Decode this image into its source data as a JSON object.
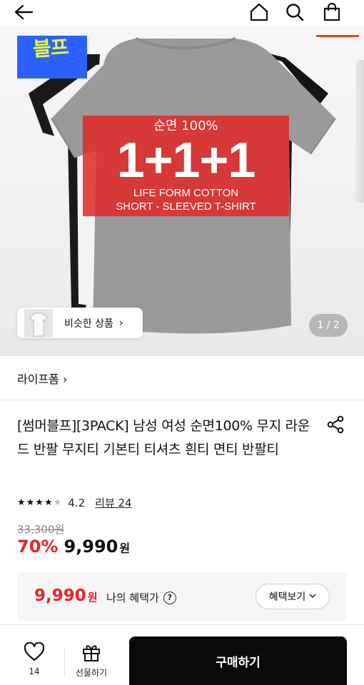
{
  "header": {
    "back_icon": "back-arrow-icon",
    "home_icon": "home-icon",
    "search_icon": "search-icon",
    "cart_icon": "shopping-bag-icon"
  },
  "hero": {
    "logo_text": "블프",
    "promo_line1": "순면 100%",
    "promo_line2": "1+1+1",
    "promo_line3": "LIFE FORM COTTON",
    "promo_line4": "SHORT - SLEEVED T-SHIRT",
    "similar_label": "비슷한 상품",
    "similar_chevron": "›",
    "pager": "1 / 2",
    "colors": {
      "promo_red": "#e12828",
      "logo_blue": "#2b62ff",
      "logo_yellow": "#e7ff33"
    }
  },
  "brand": {
    "name": "라이프폼 ›"
  },
  "product": {
    "title": "[썸머블프][3PACK] 남성 여성 순면100% 무지 라운드 반팔 무지티 기본티 티셔츠 흰티 면티 반팔티",
    "rating_stars": 4.2,
    "rating_score": "4.2",
    "review_label": "리뷰 24",
    "original_price": "33,300원",
    "discount_pct": "70%",
    "sale_price": "9,990",
    "currency": "원"
  },
  "benefit": {
    "price": "9,990",
    "currency": "원",
    "label": "나의 혜택가",
    "help": "?",
    "button": "혜택보기"
  },
  "bottom": {
    "like_count": "14",
    "gift_label": "선물하기",
    "buy_label": "구매하기",
    "colors": {
      "sale_red": "#e8232d",
      "buy_bg": "#0a0a0a"
    }
  }
}
